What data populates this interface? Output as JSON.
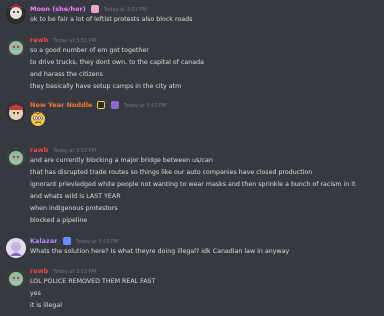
{
  "colors": {
    "background": "#36393f",
    "text": "#dcddde",
    "timestamp": "#72767d",
    "name_pink": "#f47fff",
    "name_red": "#f04747",
    "name_orange": "#f57731",
    "name_purple": "#b48cf5"
  },
  "messages": [
    {
      "author": "Moon (she/her)",
      "timestamp": "Today at 3:51 PM",
      "lines": [
        "ok to be fair a lot of leftist protests also block roads"
      ]
    },
    {
      "author": "rawb",
      "timestamp": "Today at 3:51 PM",
      "lines": [
        "so a good number of em got together",
        "to drive trucks, they dont own, to the capital of canada",
        "and harass the citizens",
        "they basically have setup camps in the city atm"
      ]
    },
    {
      "author": "New Year Noddle",
      "timestamp": "Today at 3:52 PM",
      "lines": []
    },
    {
      "author": "rawb",
      "timestamp": "Today at 3:52 PM",
      "lines": [
        "and are currently blocking a major bridge between us/can",
        "that has disrupted trade routes so things like our auto companies have closed production",
        "ignorant prievledged white people not wanting to wear masks and then sprinkle a bunch of racism in it",
        "and whats wild is LAST YEAR",
        "when indigenous protestors",
        "blocked a pipeline"
      ]
    },
    {
      "author": "Kalazar",
      "timestamp": "Today at 3:53 PM",
      "lines": [
        "Whats the solution here? Is what theyre doing illegal? idk Canadian law in anyway"
      ]
    },
    {
      "author": "rawb",
      "timestamp": "Today at 3:53 PM",
      "lines": [
        "LOL POLICE REMOVED THEM REAL FAST",
        "yes",
        "it is illegal"
      ]
    }
  ]
}
